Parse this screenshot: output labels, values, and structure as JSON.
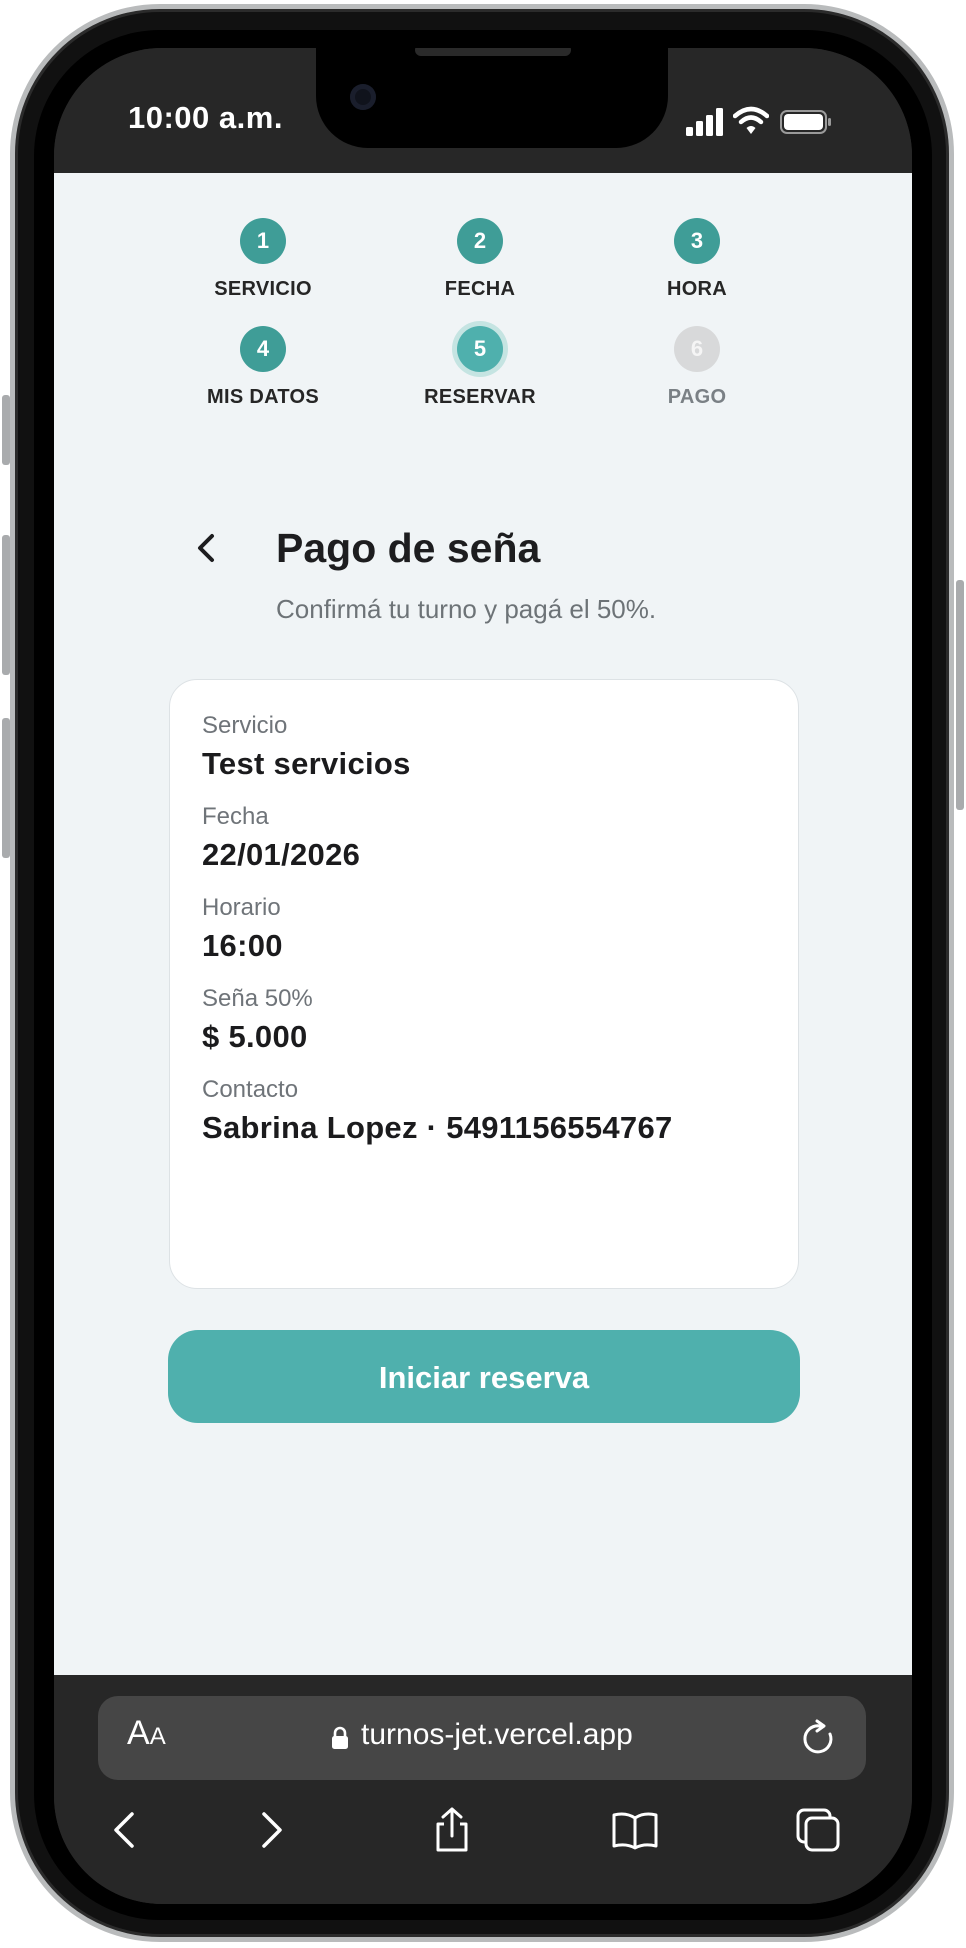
{
  "status_bar": {
    "time": "10:00 a.m."
  },
  "steps": [
    {
      "number": "1",
      "label": "SERVICIO",
      "state": "done"
    },
    {
      "number": "2",
      "label": "FECHA",
      "state": "done"
    },
    {
      "number": "3",
      "label": "HORA",
      "state": "done"
    },
    {
      "number": "4",
      "label": "MIS DATOS",
      "state": "done"
    },
    {
      "number": "5",
      "label": "RESERVAR",
      "state": "active"
    },
    {
      "number": "6",
      "label": "PAGO",
      "state": "pending"
    }
  ],
  "header": {
    "title": "Pago de seña",
    "subtitle": "Confirmá tu turno y pagá el 50%."
  },
  "summary": {
    "service_label": "Servicio",
    "service_value": "Test servicios",
    "date_label": "Fecha",
    "date_value": "22/01/2026",
    "time_label": "Horario",
    "time_value": "16:00",
    "deposit_label": "Seña 50%",
    "deposit_value": "$ 5.000",
    "contact_label": "Contacto",
    "contact_value": "Sabrina Lopez · 5491156554767"
  },
  "cta": {
    "label": "Iniciar reserva"
  },
  "browser": {
    "text_size_big": "A",
    "text_size_small": "A",
    "url": "turnos-jet.vercel.app"
  },
  "colors": {
    "accent": "#4fb0ad",
    "step_done": "#3f9d97",
    "step_pending": "#d8d9da",
    "page_bg": "#f0f4f6"
  },
  "icons": {
    "back": "chevron-left-icon",
    "lock": "lock-icon",
    "reload": "reload-icon",
    "nav_back": "chevron-left-icon",
    "nav_forward": "chevron-right-icon",
    "share": "share-icon",
    "bookmarks": "book-icon",
    "tabs": "tabs-icon"
  }
}
